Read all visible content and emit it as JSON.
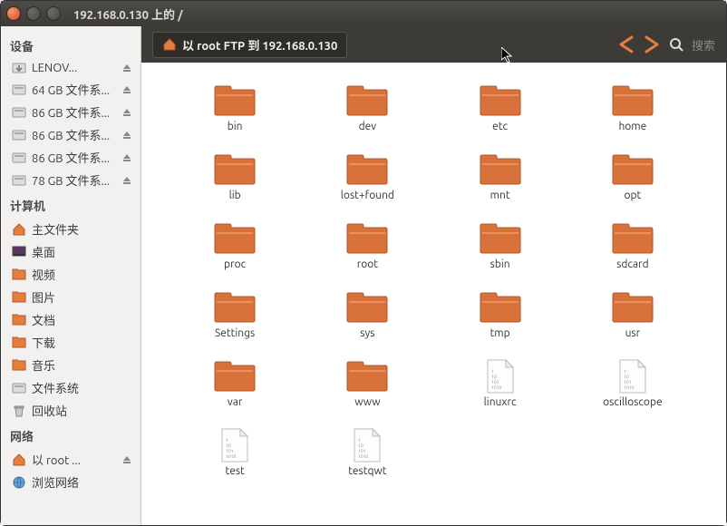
{
  "window": {
    "title": "192.168.0.130 上的 /"
  },
  "sidebar": {
    "sections": [
      {
        "header": "设备",
        "items": [
          {
            "label": "LENOV...",
            "icon": "disk",
            "eject": true
          },
          {
            "label": "64 GB 文件系...",
            "icon": "drive",
            "eject": true
          },
          {
            "label": "86 GB 文件系...",
            "icon": "drive",
            "eject": true
          },
          {
            "label": "86 GB 文件系...",
            "icon": "drive",
            "eject": true
          },
          {
            "label": "86 GB 文件系...",
            "icon": "drive",
            "eject": true
          },
          {
            "label": "78 GB 文件系...",
            "icon": "drive",
            "eject": true
          }
        ]
      },
      {
        "header": "计算机",
        "items": [
          {
            "label": "主文件夹",
            "icon": "home"
          },
          {
            "label": "桌面",
            "icon": "desktop"
          },
          {
            "label": "视频",
            "icon": "videos"
          },
          {
            "label": "图片",
            "icon": "pictures"
          },
          {
            "label": "文档",
            "icon": "documents"
          },
          {
            "label": "下载",
            "icon": "downloads"
          },
          {
            "label": "音乐",
            "icon": "music"
          },
          {
            "label": "文件系统",
            "icon": "filesystem"
          },
          {
            "label": "回收站",
            "icon": "trash"
          }
        ]
      },
      {
        "header": "网络",
        "items": [
          {
            "label": "以 root ...",
            "icon": "network-folder",
            "eject": true
          },
          {
            "label": "浏览网络",
            "icon": "network"
          }
        ]
      }
    ]
  },
  "toolbar": {
    "location": "以 root FTP 到 192.168.0.130",
    "search_placeholder": "搜索"
  },
  "files": [
    {
      "name": "bin",
      "type": "folder"
    },
    {
      "name": "dev",
      "type": "folder"
    },
    {
      "name": "etc",
      "type": "folder"
    },
    {
      "name": "home",
      "type": "folder"
    },
    {
      "name": "lib",
      "type": "folder"
    },
    {
      "name": "lost+found",
      "type": "folder"
    },
    {
      "name": "mnt",
      "type": "folder"
    },
    {
      "name": "opt",
      "type": "folder"
    },
    {
      "name": "proc",
      "type": "folder"
    },
    {
      "name": "root",
      "type": "folder"
    },
    {
      "name": "sbin",
      "type": "folder"
    },
    {
      "name": "sdcard",
      "type": "folder"
    },
    {
      "name": "Settings",
      "type": "folder"
    },
    {
      "name": "sys",
      "type": "folder"
    },
    {
      "name": "tmp",
      "type": "folder"
    },
    {
      "name": "usr",
      "type": "folder"
    },
    {
      "name": "var",
      "type": "folder"
    },
    {
      "name": "www",
      "type": "folder"
    },
    {
      "name": "linuxrc",
      "type": "file"
    },
    {
      "name": "oscilloscope",
      "type": "file"
    },
    {
      "name": "test",
      "type": "file"
    },
    {
      "name": "testqwt",
      "type": "file"
    }
  ]
}
